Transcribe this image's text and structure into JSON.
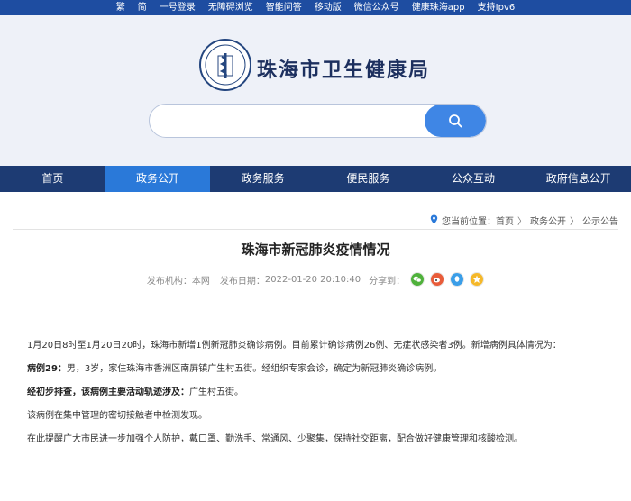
{
  "topbar": {
    "links": [
      "繁",
      "简",
      "一号登录",
      "无障碍浏览",
      "智能问答",
      "移动版",
      "微信公众号",
      "健康珠海app",
      "支持Ipv6"
    ]
  },
  "header": {
    "site_title": "珠海市卫生健康局",
    "search_placeholder": ""
  },
  "nav": {
    "items": [
      {
        "label": "首页",
        "active": false
      },
      {
        "label": "政务公开",
        "active": true
      },
      {
        "label": "政务服务",
        "active": false
      },
      {
        "label": "便民服务",
        "active": false
      },
      {
        "label": "公众互动",
        "active": false
      },
      {
        "label": "政府信息公开",
        "active": false
      }
    ]
  },
  "breadcrumb": {
    "prefix": "您当前位置：",
    "items": [
      "首页",
      "政务公开",
      "公示公告"
    ],
    "separator": "〉"
  },
  "article": {
    "title": "珠海市新冠肺炎疫情情况",
    "publisher_label": "发布机构：",
    "publisher": "本网",
    "date_label": "发布日期：",
    "date": "2022-01-20 20:10:40",
    "share_label": "分享到："
  },
  "share_icons": [
    "wechat-icon",
    "weibo-icon",
    "qq-icon",
    "qzone-icon"
  ],
  "colors": {
    "topbar": "#1e4da1",
    "nav": "#1d3b73",
    "nav_active": "#2a79d9",
    "search_button": "#3f86e5",
    "header_bg": "#eef1f8"
  },
  "content": {
    "p1": "1月20日8时至1月20日20时，珠海市新增1例新冠肺炎确诊病例。目前累计确诊病例26例、无症状感染者3例。新增病例具体情况为：",
    "p2_label": "病例29：",
    "p2_text": "男，3岁，家住珠海市香洲区南屏镇广生村五街。经组织专家会诊，确定为新冠肺炎确诊病例。",
    "p3_label": "经初步排查，该病例主要活动轨迹涉及：",
    "p3_text": "广生村五街。",
    "p4": "该病例在集中管理的密切接触者中检测发现。",
    "p5": "在此提醒广大市民进一步加强个人防护，戴口罩、勤洗手、常通风、少聚集，保持社交距离，配合做好健康管理和核酸检测。"
  }
}
